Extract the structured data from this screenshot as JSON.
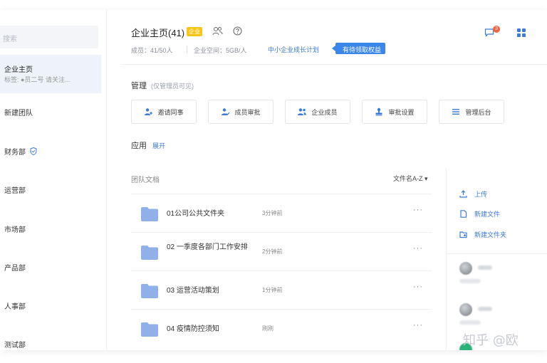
{
  "sidebar": {
    "search_placeholder": "搜索",
    "active": {
      "title": "企业主页",
      "subtitle": "标签: ●员二号 请关注..."
    },
    "items": [
      "新建团队",
      "财务部",
      "运营部",
      "市场部",
      "产品部",
      "人事部",
      "测试部"
    ]
  },
  "header": {
    "title": "企业主页(41)",
    "badge": "企业",
    "members": "成员：41/50人",
    "space": "企业空间：5GB/人",
    "plan_link": "中小企业成长计划",
    "plan_pill": "有待领取权益",
    "notification_count": "3"
  },
  "manage": {
    "title": "管理",
    "subtitle": "(仅管理员可见)",
    "buttons": [
      "邀请同事",
      "成员审批",
      "企业成员",
      "审批设置",
      "管理后台"
    ]
  },
  "apps": {
    "title": "应用",
    "expand": "展开"
  },
  "docs": {
    "title": "团队文档",
    "sort": "文件名A-Z ▾",
    "rows": [
      {
        "name": "01公司公共文件夹",
        "time": "3分钟前"
      },
      {
        "name": "02 一季度各部门工作安排",
        "time": "2分钟前"
      },
      {
        "name": "03 运营活动策划",
        "time": "1分钟前"
      },
      {
        "name": "04 疫情防控须知",
        "time": "刚刚"
      }
    ],
    "more": "···"
  },
  "right_panel": {
    "actions": [
      "上传",
      "新建文件",
      "新建文件夹"
    ]
  },
  "watermark": "知乎 @欧",
  "colors": {
    "accent": "#3b7bd9",
    "badge": "#f5c518",
    "pill": "#3b86ea",
    "active_bg": "#eef3fb"
  }
}
